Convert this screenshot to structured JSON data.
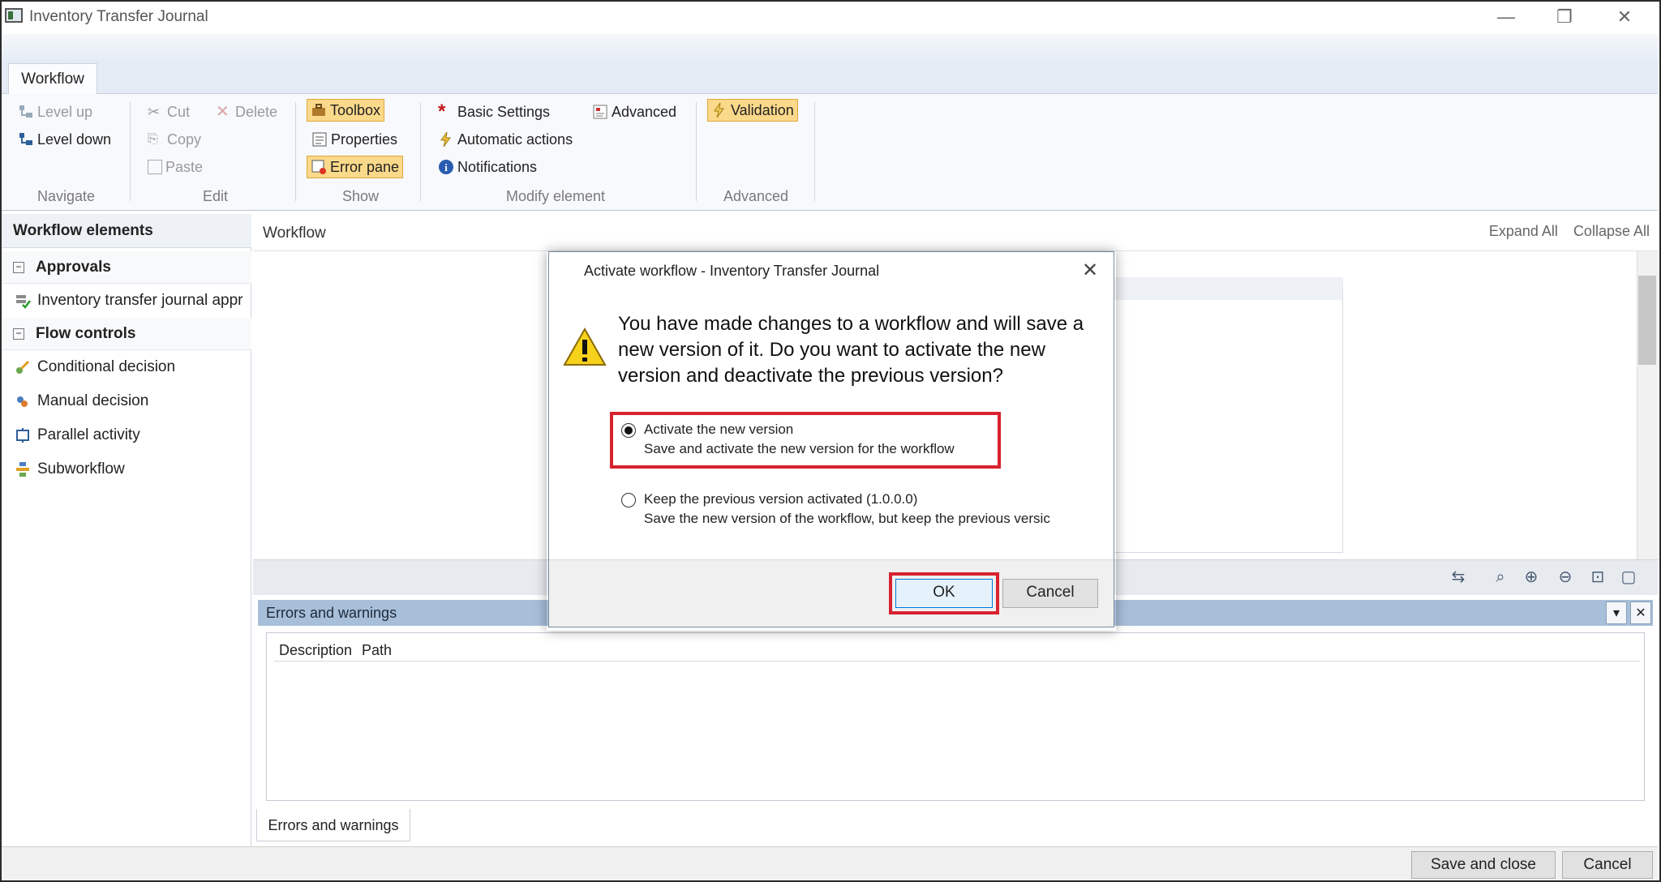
{
  "window": {
    "title": "Inventory Transfer Journal",
    "minimize": "—",
    "restore": "❐",
    "close": "✕"
  },
  "ribbon": {
    "tab": "Workflow",
    "navigate": {
      "level_up": "Level up",
      "level_down": "Level down",
      "label": "Navigate"
    },
    "edit": {
      "cut": "Cut",
      "delete": "Delete",
      "copy": "Copy",
      "paste": "Paste",
      "label": "Edit"
    },
    "show": {
      "toolbox": "Toolbox",
      "properties": "Properties",
      "error_pane": "Error pane",
      "label": "Show"
    },
    "modify": {
      "basic_settings": "Basic Settings",
      "advanced": "Advanced",
      "automatic_actions": "Automatic actions",
      "notifications": "Notifications",
      "label": "Modify element"
    },
    "advanced_group": {
      "validation": "Validation",
      "label": "Advanced"
    }
  },
  "left_pane": {
    "header": "Workflow elements",
    "groups": [
      {
        "label": "Approvals",
        "items": [
          "Inventory transfer journal appr"
        ]
      },
      {
        "label": "Flow controls",
        "items": [
          "Conditional decision",
          "Manual decision",
          "Parallel activity",
          "Subworkflow"
        ]
      }
    ]
  },
  "workflow": {
    "title": "Workflow",
    "expand_all": "Expand All",
    "collapse_all": "Collapse All"
  },
  "errors": {
    "header": "Errors and warnings",
    "columns": [
      "Description",
      "Path"
    ],
    "tab": "Errors and warnings"
  },
  "dialog": {
    "title": "Activate workflow - Inventory Transfer Journal",
    "message": "You have made changes to a workflow and will save a new version of it. Do you want to activate the new version and deactivate the previous version?",
    "options": [
      {
        "title": "Activate the new version",
        "desc": "Save and activate the new version for the workflow",
        "selected": true
      },
      {
        "title": "Keep the previous version activated (1.0.0.0)",
        "desc": "Save the new version of the workflow, but keep the previous versic",
        "selected": false
      }
    ],
    "ok": "OK",
    "cancel": "Cancel"
  },
  "footer": {
    "save_close": "Save and close",
    "cancel": "Cancel"
  },
  "colors": {
    "highlight": "#fbd98a",
    "annotation_red": "#d8222f",
    "error_header": "#a8bfd9"
  }
}
